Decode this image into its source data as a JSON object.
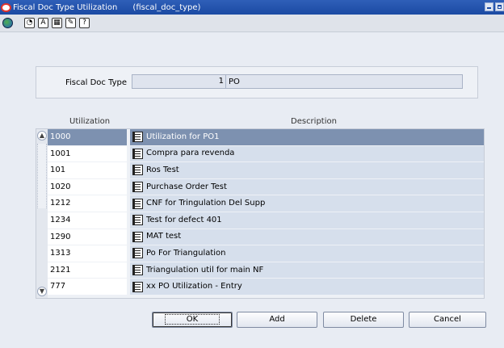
{
  "window": {
    "title": "Fiscal Doc Type Utilization      (fiscal_doc_type)"
  },
  "toolbar": {
    "icons": [
      "globe-icon",
      "help-circle-icon",
      "spell-check-icon",
      "calendar-icon",
      "edit-icon",
      "help-icon"
    ]
  },
  "form": {
    "fiscal_doc_type_label": "Fiscal Doc Type",
    "fiscal_doc_type_number": "1",
    "fiscal_doc_type_value": "PO"
  },
  "table": {
    "columns": {
      "utilization": "Utilization",
      "description": "Description"
    },
    "rows": [
      {
        "utilization": "1000",
        "description": "Utilization for PO1",
        "selected": true
      },
      {
        "utilization": "1001",
        "description": "Compra para revenda"
      },
      {
        "utilization": "101",
        "description": "Ros Test"
      },
      {
        "utilization": "1020",
        "description": "Purchase Order Test"
      },
      {
        "utilization": "1212",
        "description": "CNF for Tringulation Del Supp"
      },
      {
        "utilization": "1234",
        "description": "Test for defect 401"
      },
      {
        "utilization": "1290",
        "description": "MAT test"
      },
      {
        "utilization": "1313",
        "description": "Po For Triangulation"
      },
      {
        "utilization": "2121",
        "description": "Triangulation util for main NF"
      },
      {
        "utilization": "777",
        "description": "xx PO Utilization - Entry"
      }
    ]
  },
  "buttons": {
    "ok": "OK",
    "add": "Add",
    "delete": "Delete",
    "cancel": "Cancel"
  }
}
